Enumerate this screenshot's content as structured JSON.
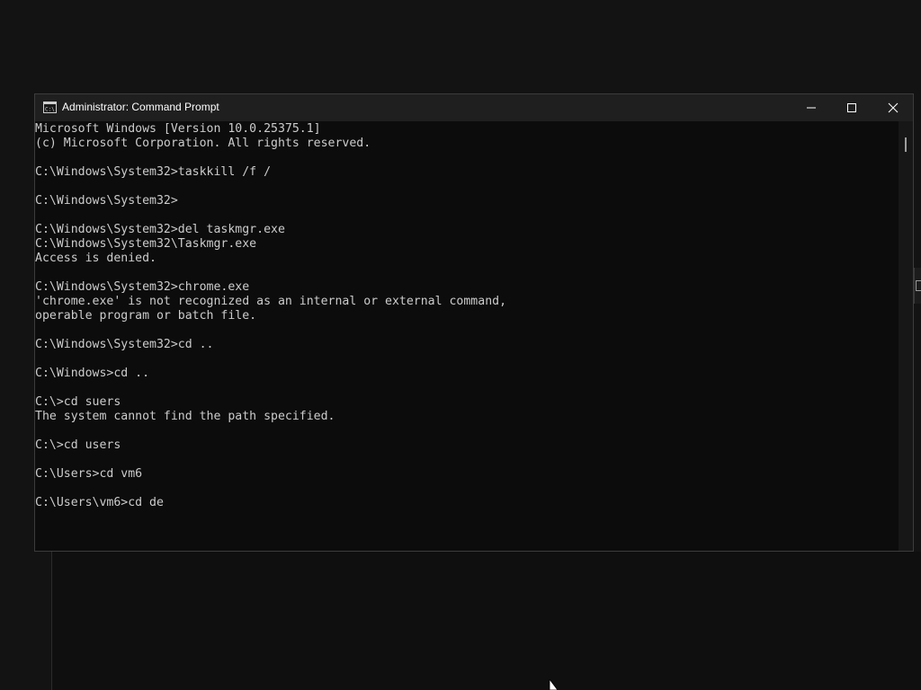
{
  "window": {
    "title": "Administrator: Command Prompt",
    "icon": "command-prompt-icon",
    "controls": {
      "minimize": "minimize-icon",
      "maximize": "maximize-icon",
      "close": "close-icon"
    }
  },
  "console": {
    "lines": [
      "Microsoft Windows [Version 10.0.25375.1]",
      "(c) Microsoft Corporation. All rights reserved.",
      "",
      "C:\\Windows\\System32>taskkill /f /",
      "",
      "C:\\Windows\\System32>",
      "",
      "C:\\Windows\\System32>del taskmgr.exe",
      "C:\\Windows\\System32\\Taskmgr.exe",
      "Access is denied.",
      "",
      "C:\\Windows\\System32>chrome.exe",
      "'chrome.exe' is not recognized as an internal or external command,",
      "operable program or batch file.",
      "",
      "C:\\Windows\\System32>cd ..",
      "",
      "C:\\Windows>cd ..",
      "",
      "C:\\>cd suers",
      "The system cannot find the path specified.",
      "",
      "C:\\>cd users",
      "",
      "C:\\Users>cd vm6",
      "",
      "C:\\Users\\vm6>cd de"
    ]
  },
  "colors": {
    "console_bg": "#0c0c0c",
    "console_text": "#cccccc",
    "titlebar_bg": "#1f1f1f"
  }
}
